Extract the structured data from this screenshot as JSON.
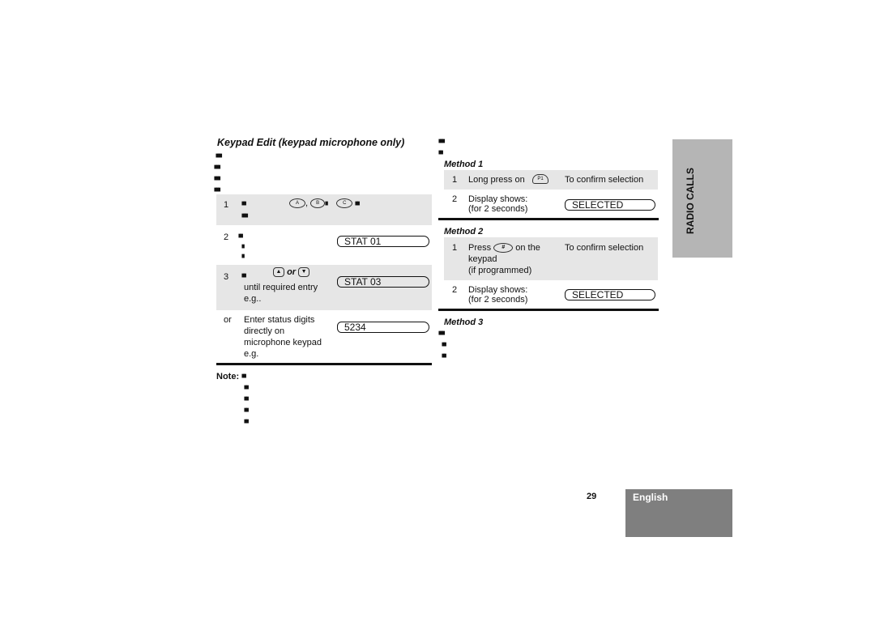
{
  "left": {
    "title": "Keypad Edit (keypad microphone only)",
    "intro_lines": [
      "■■■",
      "■■■",
      "■■■",
      "■■■"
    ],
    "steps": [
      {
        "num": "1",
        "text_lines": [
          "■■",
          "■■■"
        ],
        "keys": [
          "A",
          "B",
          "C"
        ],
        "sep1": ",",
        "sep2": "■",
        "tail": "■■"
      },
      {
        "num": "2",
        "text_lines": [
          "■■",
          "■",
          "■"
        ],
        "display": "STAT 01"
      },
      {
        "num": "3",
        "lead": "■■",
        "keys_word": "or",
        "text_lines": [
          "until required entry",
          "e.g.."
        ],
        "display": "STAT 03"
      },
      {
        "num": "or",
        "text_lines": [
          "Enter status digits",
          "directly on",
          "microphone keypad",
          "e.g."
        ],
        "display": "5234"
      }
    ],
    "note_label": "Note:",
    "note_lines": [
      "■■",
      "■■",
      "■■",
      "■■",
      "■■"
    ]
  },
  "right": {
    "intro_lines": [
      "■■■",
      "■■"
    ],
    "method1": {
      "title": "Method 1",
      "steps": [
        {
          "num": "1",
          "text": "Long press on",
          "key": "P1",
          "result": "To confirm selection"
        },
        {
          "num": "2",
          "text_lines": [
            "Display shows:",
            "(for 2 seconds)"
          ],
          "display": "SELECTED"
        }
      ]
    },
    "method2": {
      "title": "Method 2",
      "steps": [
        {
          "num": "1",
          "text_a": "Press",
          "key": "#",
          "text_b": "on the",
          "text_lines": [
            "keypad",
            "(if programmed)"
          ],
          "result": "To confirm selection"
        },
        {
          "num": "2",
          "text_lines": [
            "Display shows:",
            "(for 2 seconds)"
          ],
          "display": "SELECTED"
        }
      ]
    },
    "method3": {
      "title": "Method 3",
      "lines": [
        "■■■",
        "■■",
        "■■"
      ]
    }
  },
  "side_tab": {
    "label": "RADIO CALLS",
    "color": "#b5b5b5"
  },
  "footer": {
    "page_number": "29",
    "language": "English",
    "language_bg": "#7f7f7f"
  }
}
